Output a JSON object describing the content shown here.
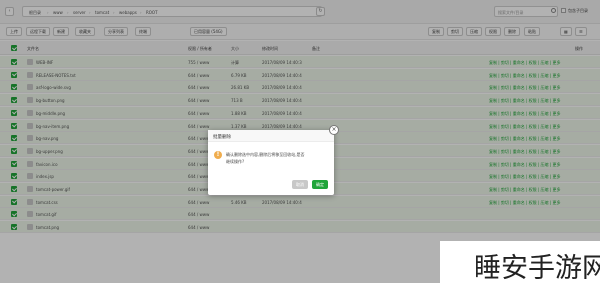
{
  "topbar": {
    "breadcrumbs": [
      "根目录",
      "www",
      "server",
      "tomcat",
      "webapps",
      "ROOT"
    ],
    "search_placeholder": "搜索文件/目录",
    "include_sub_label": "包含子目录"
  },
  "toolbar": {
    "buttons": [
      "上传",
      "远程下载",
      "新建",
      "收藏夹",
      "分享列表",
      "终端",
      "已用容量 (54G)"
    ],
    "right_buttons": [
      "复制",
      "剪切",
      "压缩",
      "权限",
      "删除",
      "粘贴"
    ]
  },
  "table": {
    "headers": [
      "文件名",
      "权限 / 所有者",
      "大小",
      "修改时间",
      "备注",
      "操作"
    ],
    "rows": [
      {
        "name": "WEB-INF",
        "perm": "755 / www",
        "size": "计算",
        "time": "2017/08/09 14:40:3",
        "ops": "复制 | 剪切 | 重命名 | 权限 | 压缩 | 更多"
      },
      {
        "name": "RELEASE-NOTES.txt",
        "perm": "644 / www",
        "size": "6.79 KB",
        "time": "2017/08/09 14:40:4",
        "ops": "复制 | 剪切 | 重命名 | 权限 | 压缩 | 更多"
      },
      {
        "name": "asf-logo-wide.svg",
        "perm": "644 / www",
        "size": "26.81 KB",
        "time": "2017/08/09 14:40:4",
        "ops": "复制 | 剪切 | 重命名 | 权限 | 压缩 | 更多"
      },
      {
        "name": "bg-button.png",
        "perm": "644 / www",
        "size": "713 B",
        "time": "2017/08/09 14:40:4",
        "ops": "复制 | 剪切 | 重命名 | 权限 | 压缩 | 更多"
      },
      {
        "name": "bg-middle.png",
        "perm": "644 / www",
        "size": "1.88 KB",
        "time": "2017/08/09 14:40:4",
        "ops": "复制 | 剪切 | 重命名 | 权限 | 压缩 | 更多"
      },
      {
        "name": "bg-nav-item.png",
        "perm": "644 / www",
        "size": "1.37 KB",
        "time": "2017/08/09 14:40:4",
        "ops": "复制 | 剪切 | 重命名 | 权限 | 压缩 | 更多"
      },
      {
        "name": "bg-nav.png",
        "perm": "644 / www",
        "size": "",
        "time": "2017/08/09 14:40:4",
        "ops": "复制 | 剪切 | 重命名 | 权限 | 压缩 | 更多"
      },
      {
        "name": "bg-upper.png",
        "perm": "644 / www",
        "size": "",
        "time": "2017/08/09 14:40:4",
        "ops": "复制 | 剪切 | 重命名 | 权限 | 压缩 | 更多"
      },
      {
        "name": "favicon.ico",
        "perm": "644 / www",
        "size": "",
        "time": "2017/08/09 14:40:4",
        "ops": "复制 | 剪切 | 重命名 | 权限 | 压缩 | 更多"
      },
      {
        "name": "index.jsp",
        "perm": "644 / www",
        "size": "11.99 KB",
        "time": "2017/08/09 14:40:4",
        "ops": "复制 | 剪切 | 重命名 | 权限 | 压缩 | 更多"
      },
      {
        "name": "tomcat-power.gif",
        "perm": "644 / www",
        "size": "2.02 KB",
        "time": "2017/08/09 14:40:4",
        "ops": "复制 | 剪切 | 重命名 | 权限 | 压缩 | 更多"
      },
      {
        "name": "tomcat.css",
        "perm": "644 / www",
        "size": "5.46 KB",
        "time": "2017/08/09 14:40:4",
        "ops": "复制 | 剪切 | 重命名 | 权限 | 压缩 | 更多"
      },
      {
        "name": "tomcat.gif",
        "perm": "644 / www",
        "size": "",
        "time": "",
        "ops": ""
      },
      {
        "name": "tomcat.png",
        "perm": "644 / www",
        "size": "",
        "time": "",
        "ops": ""
      }
    ]
  },
  "dialog": {
    "title": "批量删除",
    "message_line1": "确认删除选中内容,删除后将移至回收站,是否",
    "message_line2": "继续操作?",
    "cancel_label": "取消",
    "ok_label": "确定"
  },
  "watermark": "睡安手游网",
  "colors": {
    "accent": "#20a53a",
    "warning": "#f0ad4e"
  }
}
